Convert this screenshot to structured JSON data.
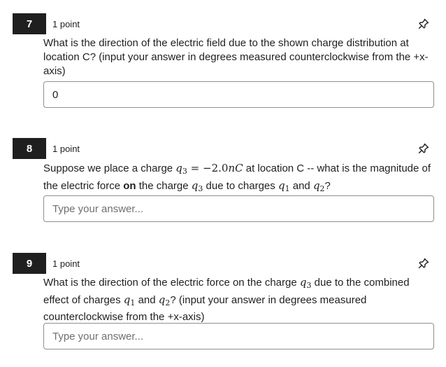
{
  "questions": [
    {
      "number": "7",
      "points": "1 point",
      "prompt": "What is the direction of the electric field due to the shown charge distribution at location C? (input your answer in degrees measured counterclockwise from the +x-axis)",
      "answer_value": "0",
      "answer_placeholder": ""
    },
    {
      "number": "8",
      "points": "1 point",
      "prompt_parts": {
        "a": "Suppose we place a charge ",
        "q3": "q",
        "q3_sub": "3",
        "eq": " = −2.0",
        "nC": "nC",
        "b": " at location C -- what is the magnitude of the electric force ",
        "on": "on",
        "c": " the charge ",
        "d": " due to charges ",
        "q1": "q",
        "q1_sub": "1",
        "and": " and ",
        "q2": "q",
        "q2_sub": "2",
        "end": "?"
      },
      "answer_value": "",
      "answer_placeholder": "Type your answer..."
    },
    {
      "number": "9",
      "points": "1 point",
      "prompt_parts": {
        "a": "What is the direction of the electric force on the charge ",
        "q3": "q",
        "q3_sub": "3",
        "b": " due to the combined effect of charges ",
        "q1": "q",
        "q1_sub": "1",
        "and": " and ",
        "q2": "q",
        "q2_sub": "2",
        "c": "? (input your answer in degrees measured counterclockwise from the +x-axis)"
      },
      "answer_value": "",
      "answer_placeholder": "Type your answer..."
    }
  ],
  "icons": {
    "pin": "pin-icon"
  },
  "colors": {
    "badge": "#1f1f1f",
    "border": "#8f8f8f",
    "placeholder": "#6f6f6f"
  }
}
